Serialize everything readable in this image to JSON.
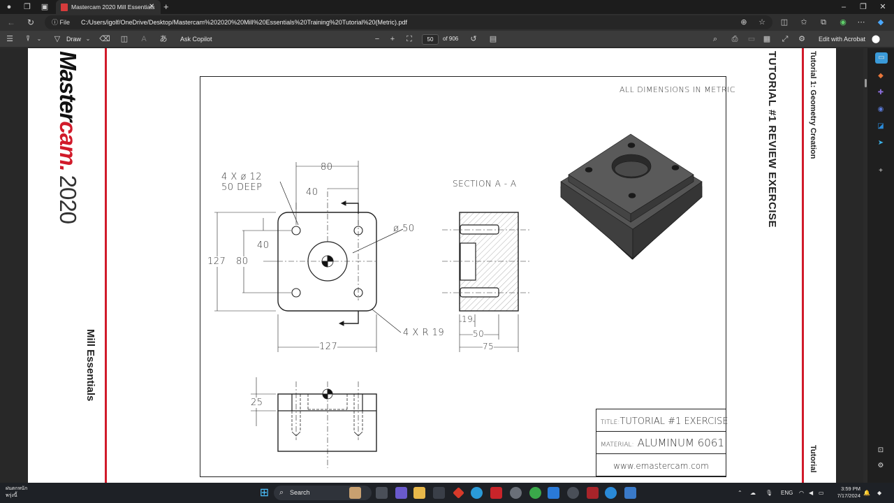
{
  "browser": {
    "tab_title": "Mastercam 2020 Mill Essentials",
    "url_scheme": "File",
    "url": "C:/Users/igolf/OneDrive/Desktop/Mastercam%202020%20Mill%20Essentials%20Training%20Tutorial%20(Metric).pdf"
  },
  "pdf_toolbar": {
    "draw_label": "Draw",
    "copilot_label": "Ask Copilot",
    "page_current": "50",
    "page_total": "of 906",
    "acrobat_label": "Edit with Acrobat"
  },
  "page": {
    "brand_main": "Master",
    "brand_accent": "cam.",
    "brand_year": "2020",
    "left_footer": "Mill Essentials",
    "right_title": "TUTORIAL #1 REVIEW EXERCISE",
    "right_header": "Tutorial 1: Geometry Creation",
    "right_footer": "Tutorial"
  },
  "drawing": {
    "units_note": "ALL DIMENSIONS IN METRIC",
    "section_label": "SECTION A - A",
    "hole_note_line1": "4 X ø 12",
    "hole_note_line2": "50 DEEP",
    "dim_top_80": "80",
    "dim_top_40": "40",
    "dim_bore": "ø 50",
    "dim_side_127": "127",
    "dim_side_80": "80",
    "dim_side_40": "40",
    "dim_bottom_127": "127",
    "dim_radius": "4 X R 19",
    "dim_sec_19": "19",
    "dim_sec_50": "50",
    "dim_sec_75": "75",
    "dim_front_25": "25",
    "title_label": "TITLE:",
    "title_value": "TUTORIAL #1 EXERCISE",
    "material_label": "MATERIAL:",
    "material_value": "ALUMINUM 6061",
    "website": "www.emastercam.com"
  },
  "taskbar": {
    "search_label": "Search",
    "weather_line1": "ฝนตกหนัก",
    "weather_line2": "พรุ่งนี้",
    "language": "ENG",
    "time": "3:59 PM",
    "date": "7/17/2024"
  },
  "colors": {
    "brand_red": "#d11a2a",
    "page_bg": "#ffffff",
    "viewer_bg": "#282828"
  }
}
